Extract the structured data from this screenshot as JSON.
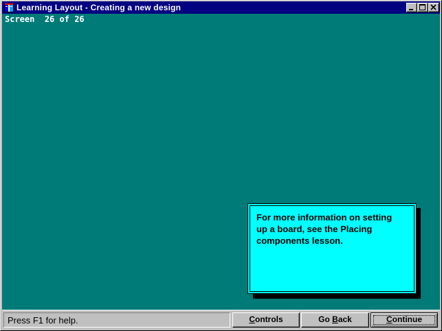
{
  "window": {
    "title": "Learning Layout - Creating a new design",
    "icon": "book-icon",
    "title_bar_color": "#000080",
    "background_color": "#007b78"
  },
  "header": {
    "screen_label": "Screen",
    "screen_current": "26",
    "screen_of": "of",
    "screen_total": "26"
  },
  "info_box": {
    "lines": [
      "For more information on setting",
      "up a board, see the Placing",
      "components lesson."
    ],
    "background_color": "#00ffff"
  },
  "status": {
    "text": "Press F1 for help."
  },
  "buttons": {
    "controls": {
      "mnemonic": "C",
      "rest": "ontrols"
    },
    "go_back": {
      "before": "Go ",
      "mnemonic": "B",
      "rest": "ack"
    },
    "continue": {
      "mnemonic": "C",
      "rest": "ontinue"
    }
  }
}
